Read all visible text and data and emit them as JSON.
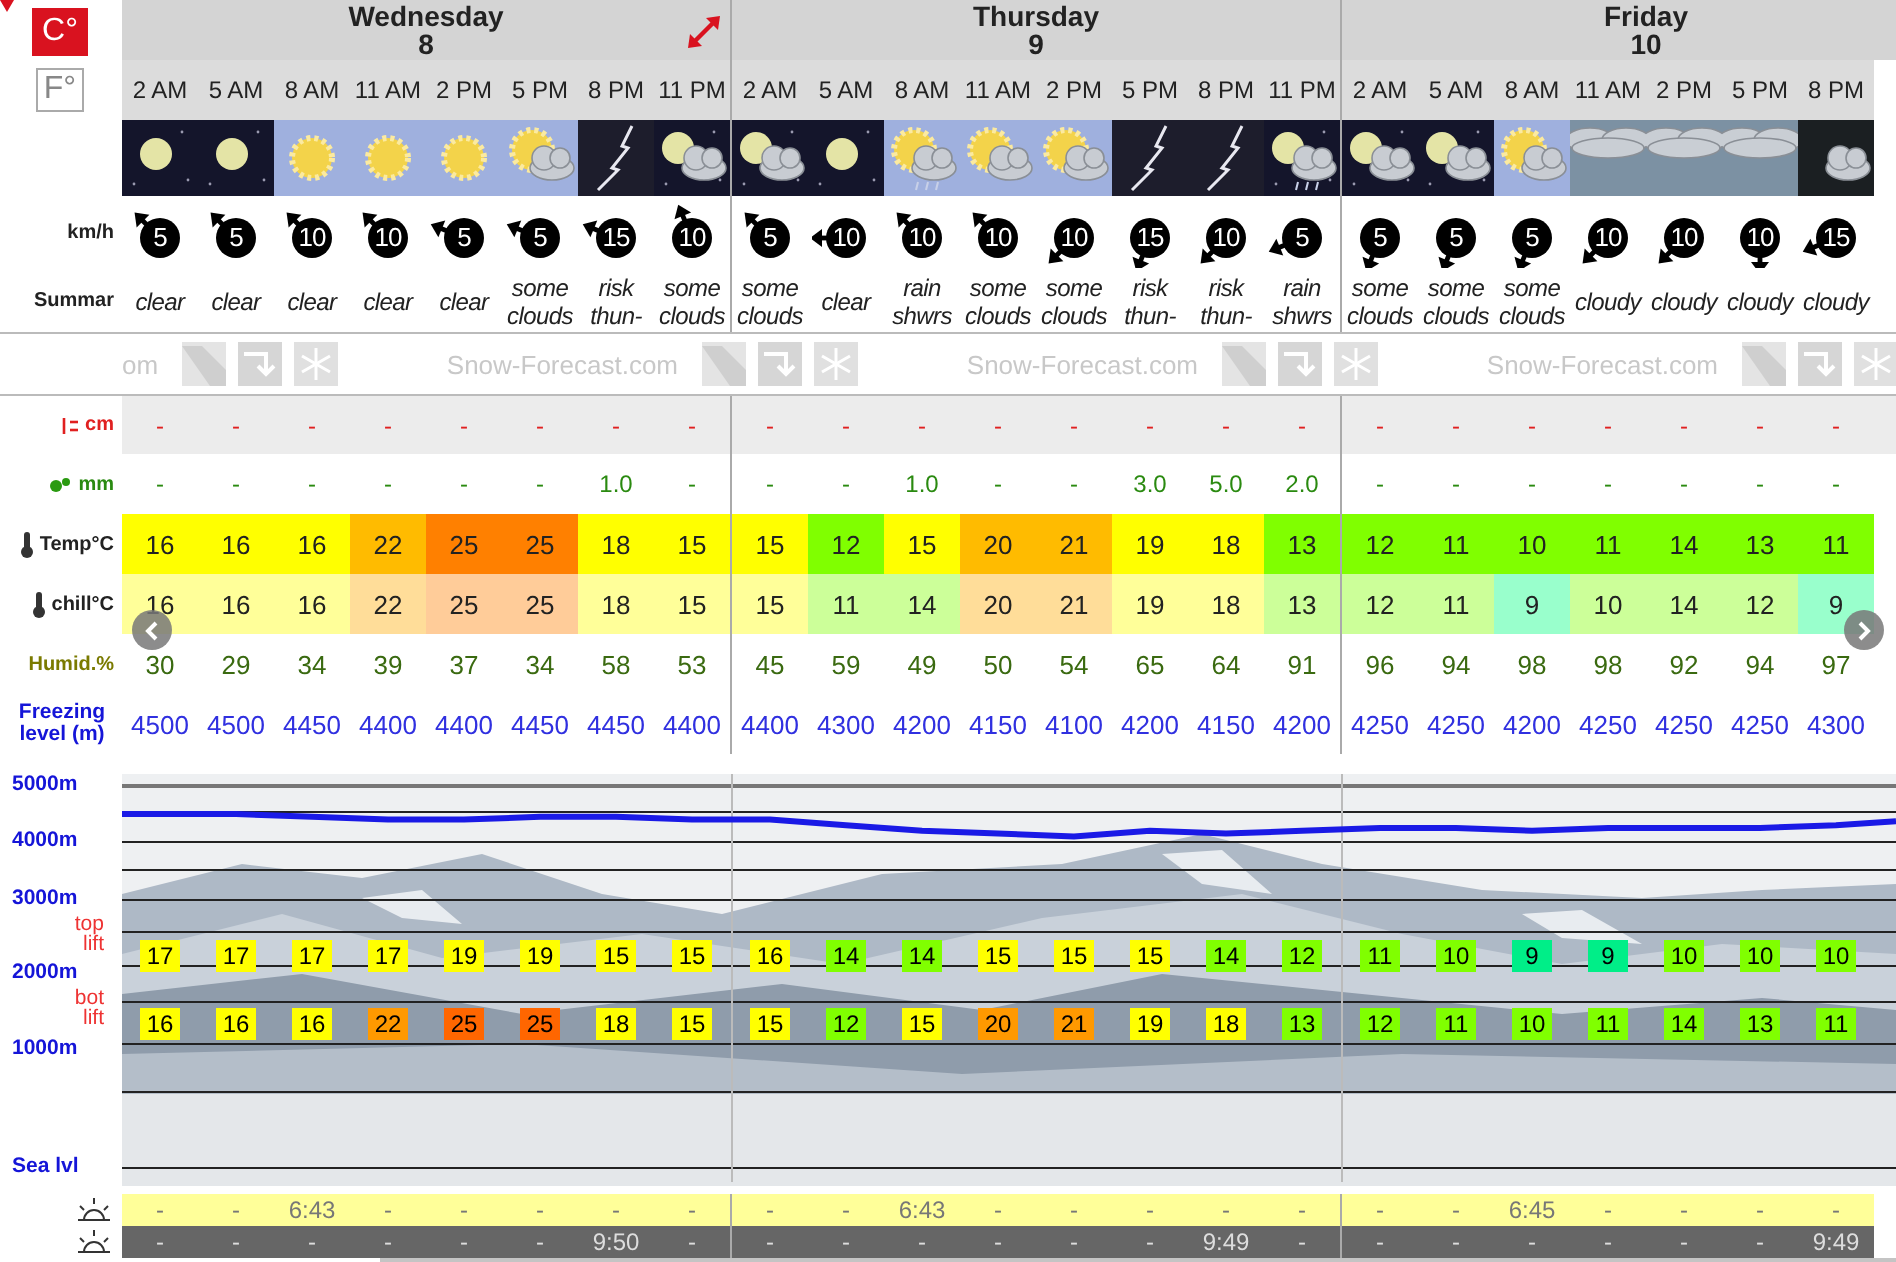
{
  "units": [
    {
      "label": "C°",
      "selected": true
    },
    {
      "label": "F°",
      "selected": false
    }
  ],
  "row_labels": {
    "wind": "km/h",
    "summary": "Summar",
    "snow": "cm",
    "rain": "mm",
    "temp": "Temp°C",
    "chill": "chill°C",
    "humidity": "Humid.%",
    "freezing": "Freezing level (m)"
  },
  "logo_texts": [
    "om",
    "Snow-Forecast.com",
    "Snow-Forecast.com",
    "Snow-Forecast.com"
  ],
  "altitudes": [
    "5000m",
    "4000m",
    "3000m",
    "2000m",
    "1000m",
    "Sea lvl"
  ],
  "lift_labels": {
    "top": "top lift",
    "bot": "bot lift"
  },
  "days": [
    {
      "name": "Wednesday",
      "date": "8",
      "hours": [
        {
          "time": "2 AM",
          "weather": {
            "kind": "clear_night"
          },
          "wind": {
            "kind": "nw",
            "speed": "5"
          },
          "summary": "clear",
          "snow": "-",
          "rain": "-",
          "temp": "16",
          "chill": "16",
          "humidity": "30",
          "freezing": "4500",
          "top_lift": "17",
          "bot_lift": "16",
          "sunrise": "-",
          "sunset": "-"
        },
        {
          "time": "5 AM",
          "weather": {
            "kind": "clear_night"
          },
          "wind": {
            "kind": "nw",
            "speed": "5"
          },
          "summary": "clear",
          "snow": "-",
          "rain": "-",
          "temp": "16",
          "chill": "16",
          "humidity": "29",
          "freezing": "4500",
          "top_lift": "17",
          "bot_lift": "16",
          "sunrise": "-",
          "sunset": "-"
        },
        {
          "time": "8 AM",
          "weather": {
            "kind": "sunny"
          },
          "wind": {
            "kind": "nw",
            "speed": "10"
          },
          "summary": "clear",
          "snow": "-",
          "rain": "-",
          "temp": "16",
          "chill": "16",
          "humidity": "34",
          "freezing": "4450",
          "top_lift": "17",
          "bot_lift": "16",
          "sunrise": "6:43",
          "sunset": "-"
        },
        {
          "time": "11 AM",
          "weather": {
            "kind": "sunny"
          },
          "wind": {
            "kind": "nw",
            "speed": "10"
          },
          "summary": "clear",
          "snow": "-",
          "rain": "-",
          "temp": "22",
          "chill": "22",
          "humidity": "39",
          "freezing": "4400",
          "top_lift": "17",
          "bot_lift": "22",
          "sunrise": "-",
          "sunset": "-"
        },
        {
          "time": "2 PM",
          "weather": {
            "kind": "sunny"
          },
          "wind": {
            "kind": "wnw",
            "speed": "5"
          },
          "summary": "clear",
          "snow": "-",
          "rain": "-",
          "temp": "25",
          "chill": "25",
          "humidity": "37",
          "freezing": "4400",
          "top_lift": "19",
          "bot_lift": "25",
          "sunrise": "-",
          "sunset": "-"
        },
        {
          "time": "5 PM",
          "weather": {
            "kind": "sun_cloud"
          },
          "wind": {
            "kind": "wnw",
            "speed": "5"
          },
          "summary": "some clouds",
          "snow": "-",
          "rain": "-",
          "temp": "25",
          "chill": "25",
          "humidity": "34",
          "freezing": "4450",
          "top_lift": "19",
          "bot_lift": "25",
          "sunrise": "-",
          "sunset": "-"
        },
        {
          "time": "8 PM",
          "weather": {
            "kind": "thunder"
          },
          "wind": {
            "kind": "wnw",
            "speed": "15"
          },
          "summary": "risk thun-",
          "snow": "-",
          "rain": "1.0",
          "temp": "18",
          "chill": "18",
          "humidity": "58",
          "freezing": "4450",
          "top_lift": "15",
          "bot_lift": "18",
          "sunrise": "-",
          "sunset": "9:50"
        },
        {
          "time": "11 PM",
          "weather": {
            "kind": "moon_cloud"
          },
          "wind": {
            "kind": "nnw",
            "speed": "10"
          },
          "summary": "some clouds",
          "snow": "-",
          "rain": "-",
          "temp": "15",
          "chill": "15",
          "humidity": "53",
          "freezing": "4400",
          "top_lift": "15",
          "bot_lift": "15",
          "sunrise": "-",
          "sunset": "-"
        }
      ]
    },
    {
      "name": "Thursday",
      "date": "9",
      "hours": [
        {
          "time": "2 AM",
          "weather": {
            "kind": "moon_cloud"
          },
          "wind": {
            "kind": "nw",
            "speed": "5"
          },
          "summary": "some clouds",
          "snow": "-",
          "rain": "-",
          "temp": "15",
          "chill": "15",
          "humidity": "45",
          "freezing": "4400",
          "top_lift": "16",
          "bot_lift": "15",
          "sunrise": "-",
          "sunset": "-"
        },
        {
          "time": "5 AM",
          "weather": {
            "kind": "clear_night"
          },
          "wind": {
            "kind": "w",
            "speed": "10"
          },
          "summary": "clear",
          "snow": "-",
          "rain": "-",
          "temp": "12",
          "chill": "11",
          "humidity": "59",
          "freezing": "4300",
          "top_lift": "14",
          "bot_lift": "12",
          "sunrise": "-",
          "sunset": "-"
        },
        {
          "time": "8 AM",
          "weather": {
            "kind": "rain_sun"
          },
          "wind": {
            "kind": "nw",
            "speed": "10"
          },
          "summary": "rain shwrs",
          "snow": "-",
          "rain": "1.0",
          "temp": "15",
          "chill": "14",
          "humidity": "49",
          "freezing": "4200",
          "top_lift": "14",
          "bot_lift": "15",
          "sunrise": "6:43",
          "sunset": "-"
        },
        {
          "time": "11 AM",
          "weather": {
            "kind": "sun_cloud"
          },
          "wind": {
            "kind": "nw",
            "speed": "10"
          },
          "summary": "some clouds",
          "snow": "-",
          "rain": "-",
          "temp": "20",
          "chill": "20",
          "humidity": "50",
          "freezing": "4150",
          "top_lift": "15",
          "bot_lift": "20",
          "sunrise": "-",
          "sunset": "-"
        },
        {
          "time": "2 PM",
          "weather": {
            "kind": "sun_cloud"
          },
          "wind": {
            "kind": "sw",
            "speed": "10"
          },
          "summary": "some clouds",
          "snow": "-",
          "rain": "-",
          "temp": "21",
          "chill": "21",
          "humidity": "54",
          "freezing": "4100",
          "top_lift": "15",
          "bot_lift": "21",
          "sunrise": "-",
          "sunset": "-"
        },
        {
          "time": "5 PM",
          "weather": {
            "kind": "thunder"
          },
          "wind": {
            "kind": "ssw",
            "speed": "15"
          },
          "summary": "risk thun-",
          "snow": "-",
          "rain": "3.0",
          "temp": "19",
          "chill": "19",
          "humidity": "65",
          "freezing": "4200",
          "top_lift": "15",
          "bot_lift": "19",
          "sunrise": "-",
          "sunset": "-"
        },
        {
          "time": "8 PM",
          "weather": {
            "kind": "thunder"
          },
          "wind": {
            "kind": "sw",
            "speed": "10"
          },
          "summary": "risk thun-",
          "snow": "-",
          "rain": "5.0",
          "temp": "18",
          "chill": "18",
          "humidity": "64",
          "freezing": "4150",
          "top_lift": "14",
          "bot_lift": "18",
          "sunrise": "-",
          "sunset": "9:49"
        },
        {
          "time": "11 PM",
          "weather": {
            "kind": "moon_rain"
          },
          "wind": {
            "kind": "wsw",
            "speed": "5"
          },
          "summary": "rain shwrs",
          "snow": "-",
          "rain": "2.0",
          "temp": "13",
          "chill": "13",
          "humidity": "91",
          "freezing": "4200",
          "top_lift": "12",
          "bot_lift": "13",
          "sunrise": "-",
          "sunset": "-"
        }
      ]
    },
    {
      "name": "Friday",
      "date": "10",
      "hours": [
        {
          "time": "2 AM",
          "weather": {
            "kind": "moon_cloud"
          },
          "wind": {
            "kind": "ssw",
            "speed": "5"
          },
          "summary": "some clouds",
          "snow": "-",
          "rain": "-",
          "temp": "12",
          "chill": "12",
          "humidity": "96",
          "freezing": "4250",
          "top_lift": "11",
          "bot_lift": "12",
          "sunrise": "-",
          "sunset": "-"
        },
        {
          "time": "5 AM",
          "weather": {
            "kind": "moon_cloud"
          },
          "wind": {
            "kind": "ssw",
            "speed": "5"
          },
          "summary": "some clouds",
          "snow": "-",
          "rain": "-",
          "temp": "11",
          "chill": "11",
          "humidity": "94",
          "freezing": "4250",
          "top_lift": "10",
          "bot_lift": "11",
          "sunrise": "-",
          "sunset": "-"
        },
        {
          "time": "8 AM",
          "weather": {
            "kind": "sun_cloud"
          },
          "wind": {
            "kind": "ssw",
            "speed": "5"
          },
          "summary": "some clouds",
          "snow": "-",
          "rain": "-",
          "temp": "10",
          "chill": "9",
          "humidity": "98",
          "freezing": "4200",
          "top_lift": "9",
          "bot_lift": "10",
          "sunrise": "6:45",
          "sunset": "-"
        },
        {
          "time": "11 AM",
          "weather": {
            "kind": "overcast"
          },
          "wind": {
            "kind": "sw",
            "speed": "10"
          },
          "summary": "cloudy",
          "snow": "-",
          "rain": "-",
          "temp": "11",
          "chill": "10",
          "humidity": "98",
          "freezing": "4250",
          "top_lift": "9",
          "bot_lift": "11",
          "sunrise": "-",
          "sunset": "-"
        },
        {
          "time": "2 PM",
          "weather": {
            "kind": "overcast"
          },
          "wind": {
            "kind": "sw",
            "speed": "10"
          },
          "summary": "cloudy",
          "snow": "-",
          "rain": "-",
          "temp": "14",
          "chill": "14",
          "humidity": "92",
          "freezing": "4250",
          "top_lift": "10",
          "bot_lift": "14",
          "sunrise": "-",
          "sunset": "-"
        },
        {
          "time": "5 PM",
          "weather": {
            "kind": "overcast"
          },
          "wind": {
            "kind": "s",
            "speed": "10"
          },
          "summary": "cloudy",
          "snow": "-",
          "rain": "-",
          "temp": "13",
          "chill": "12",
          "humidity": "94",
          "freezing": "4250",
          "top_lift": "10",
          "bot_lift": "13",
          "sunrise": "-",
          "sunset": "-"
        },
        {
          "time": "8 PM",
          "weather": {
            "kind": "night_cloud"
          },
          "wind": {
            "kind": "wsw",
            "speed": "15"
          },
          "summary": "cloudy",
          "snow": "-",
          "rain": "-",
          "temp": "11",
          "chill": "9",
          "humidity": "97",
          "freezing": "4300",
          "top_lift": "10",
          "bot_lift": "11",
          "sunrise": "-",
          "sunset": "9:49"
        }
      ]
    }
  ]
}
